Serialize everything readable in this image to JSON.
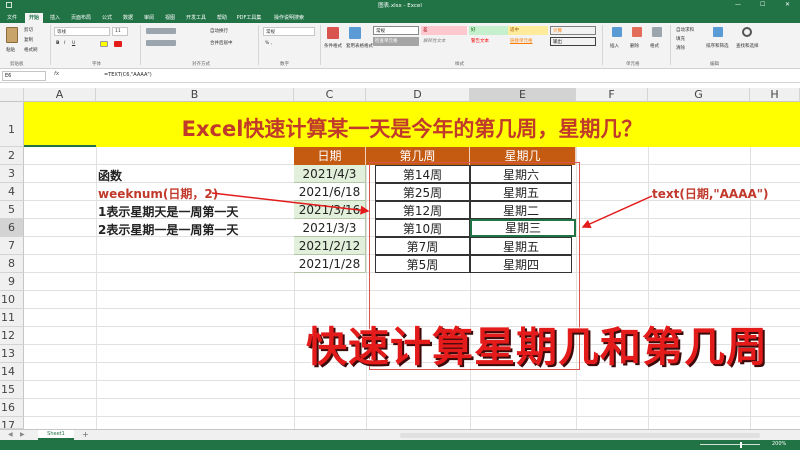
{
  "window": {
    "title": "图表.xlsx - Excel",
    "min": "—",
    "max": "☐",
    "close": "✕"
  },
  "tabs": [
    {
      "label": "文件"
    },
    {
      "label": "开始"
    },
    {
      "label": "插入"
    },
    {
      "label": "页面布局"
    },
    {
      "label": "公式"
    },
    {
      "label": "数据"
    },
    {
      "label": "审阅"
    },
    {
      "label": "视图"
    },
    {
      "label": "开发工具"
    },
    {
      "label": "帮助"
    },
    {
      "label": "PDF工具集"
    },
    {
      "label": "操作说明搜索"
    }
  ],
  "ribbon": {
    "clipboard": {
      "paste": "粘贴",
      "cut": "剪切",
      "copy": "复制",
      "format_painter": "格式刷",
      "label": "剪贴板"
    },
    "font": {
      "name": "等线",
      "size": "11",
      "label": "字体"
    },
    "alignment": {
      "wrap": "自动换行",
      "merge": "合并后居中",
      "label": "对齐方式"
    },
    "number": {
      "format": "常规",
      "label": "数字"
    },
    "styles": {
      "conditional": "条件格式",
      "table": "套用表格格式",
      "cells": [
        "常规",
        "差",
        "好",
        "适中",
        "计算",
        "检查单元格",
        "解释性文本",
        "警告文本",
        "链接单元格",
        "输出"
      ],
      "label": "样式"
    },
    "cells_group": {
      "insert": "插入",
      "delete": "删除",
      "format": "格式",
      "label": "单元格"
    },
    "editing": {
      "autosum": "自动求和",
      "fill": "填充",
      "clear": "清除",
      "sort": "排序和筛选",
      "find": "查找和选择",
      "label": "编辑"
    }
  },
  "formula_bar": {
    "name_box": "E6",
    "fx": "fx",
    "formula": "=TEXT(C6,\"AAAA\")"
  },
  "columns": [
    "A",
    "B",
    "C",
    "D",
    "E",
    "F",
    "G",
    "H"
  ],
  "rows": [
    "1",
    "2",
    "3",
    "4",
    "5",
    "6",
    "7",
    "8",
    "9",
    "10",
    "11",
    "12",
    "13",
    "14",
    "15",
    "16",
    "17"
  ],
  "banner": "Excel快速计算某一天是今年的第几周，星期几？",
  "table": {
    "headers": [
      "日期",
      "第几周",
      "星期几"
    ],
    "rows": [
      {
        "date": "2021/4/3",
        "week": "第14周",
        "day": "星期六"
      },
      {
        "date": "2021/6/18",
        "week": "第25周",
        "day": "星期五"
      },
      {
        "date": "2021/3/16",
        "week": "第12周",
        "day": "星期二"
      },
      {
        "date": "2021/3/3",
        "week": "第10周",
        "day": "星期三"
      },
      {
        "date": "2021/2/12",
        "week": "第7周",
        "day": "星期五"
      },
      {
        "date": "2021/1/28",
        "week": "第5周",
        "day": "星期四"
      }
    ]
  },
  "notes": {
    "func": "函数",
    "weeknum": "weeknum(日期，2)",
    "line1": "1表示星期天是一周第一天",
    "line2": "2表示星期一是一周第一天",
    "text_func": "text(日期,\"AAAA\")"
  },
  "overlay_title": "快速计算星期几和第几周",
  "sheet": {
    "tab": "Sheet1",
    "add": "+"
  },
  "status": {
    "zoom": "200%"
  },
  "colors": {
    "excel_green": "#217346",
    "header_orange": "#c55a11",
    "banner_yellow": "#ffff00",
    "date_green": "#e2efda",
    "red": "#e31b1b"
  }
}
